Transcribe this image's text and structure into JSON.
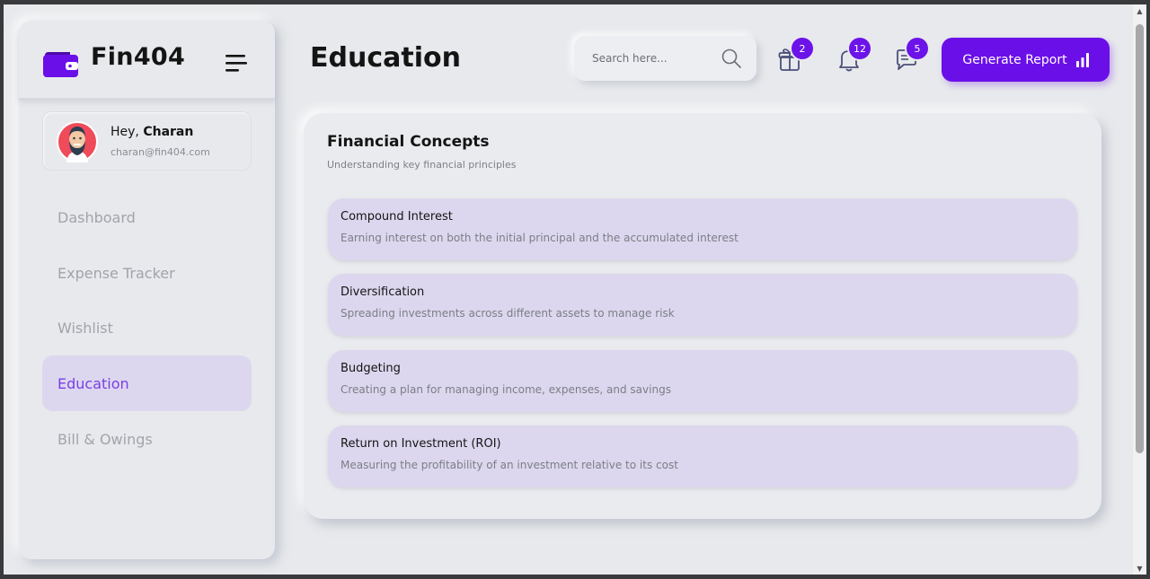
{
  "app": {
    "name": "Fin404",
    "brand_color": "#6b0fe8"
  },
  "user": {
    "greeting": "Hey,",
    "name": "Charan",
    "email": "charan@fin404.com"
  },
  "sidebar": {
    "items": [
      {
        "label": "Dashboard",
        "active": false
      },
      {
        "label": "Expense Tracker",
        "active": false
      },
      {
        "label": "Wishlist",
        "active": false
      },
      {
        "label": "Education",
        "active": true
      },
      {
        "label": "Bill & Owings",
        "active": false
      }
    ]
  },
  "header": {
    "title": "Education",
    "search_placeholder": "Search here...",
    "gift_count": "2",
    "notification_count": "12",
    "message_count": "5",
    "generate_label": "Generate Report"
  },
  "main": {
    "title": "Financial Concepts",
    "subtitle": "Understanding key financial principles",
    "concepts": [
      {
        "title": "Compound Interest",
        "description": "Earning interest on both the initial principal and the accumulated interest"
      },
      {
        "title": "Diversification",
        "description": "Spreading investments across different assets to manage risk"
      },
      {
        "title": "Budgeting",
        "description": "Creating a plan for managing income, expenses, and savings"
      },
      {
        "title": "Return on Investment (ROI)",
        "description": "Measuring the profitability of an investment relative to its cost"
      }
    ]
  }
}
